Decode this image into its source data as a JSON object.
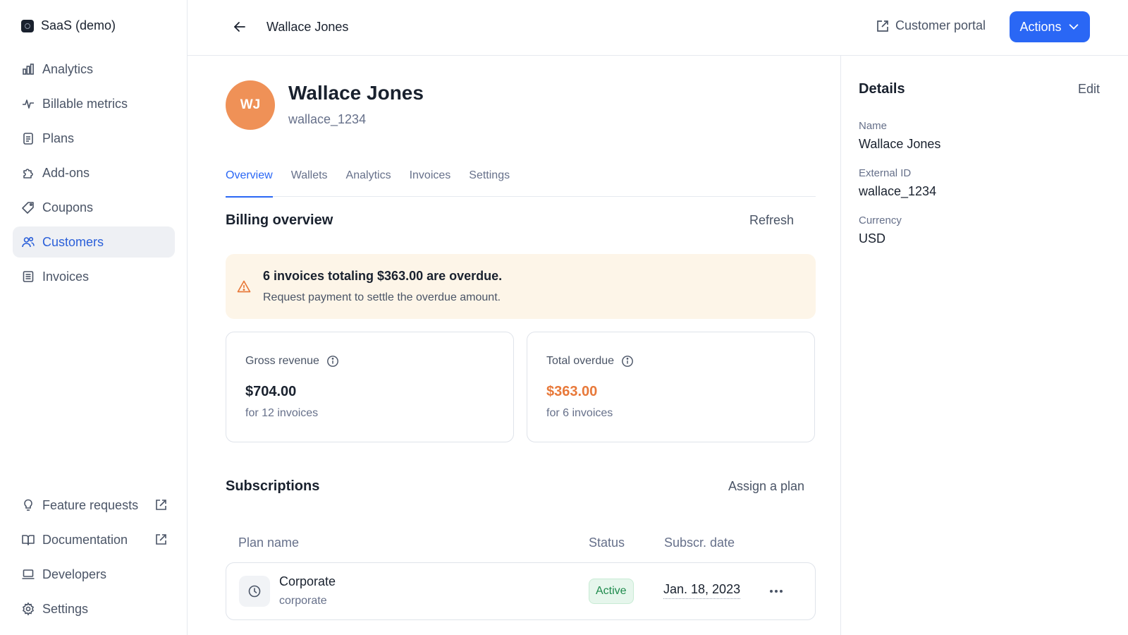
{
  "org": {
    "name": "SaaS (demo)"
  },
  "nav": {
    "items": [
      {
        "label": "Analytics",
        "icon": "bar-chart-icon"
      },
      {
        "label": "Billable metrics",
        "icon": "pulse-icon"
      },
      {
        "label": "Plans",
        "icon": "clipboard-icon"
      },
      {
        "label": "Add-ons",
        "icon": "puzzle-icon"
      },
      {
        "label": "Coupons",
        "icon": "tag-icon"
      },
      {
        "label": "Customers",
        "icon": "users-icon",
        "active": true
      },
      {
        "label": "Invoices",
        "icon": "document-icon"
      }
    ],
    "bottom": [
      {
        "label": "Feature requests",
        "icon": "lightbulb-icon",
        "external": true
      },
      {
        "label": "Documentation",
        "icon": "book-icon",
        "external": true
      },
      {
        "label": "Developers",
        "icon": "laptop-icon"
      },
      {
        "label": "Settings",
        "icon": "gear-icon"
      }
    ]
  },
  "header": {
    "title": "Wallace Jones",
    "portal_label": "Customer portal",
    "actions_label": "Actions"
  },
  "customer": {
    "initials": "WJ",
    "name": "Wallace Jones",
    "external_id": "wallace_1234"
  },
  "tabs": [
    {
      "label": "Overview",
      "active": true
    },
    {
      "label": "Wallets"
    },
    {
      "label": "Analytics"
    },
    {
      "label": "Invoices"
    },
    {
      "label": "Settings"
    }
  ],
  "billing": {
    "title": "Billing overview",
    "refresh_label": "Refresh",
    "alert_title": "6 invoices totaling $363.00 are overdue.",
    "alert_sub": "Request payment to settle the overdue amount.",
    "gross": {
      "label": "Gross revenue",
      "value": "$704.00",
      "sub": "for 12 invoices"
    },
    "overdue": {
      "label": "Total overdue",
      "value": "$363.00",
      "sub": "for 6 invoices"
    }
  },
  "subscriptions": {
    "title": "Subscriptions",
    "assign_label": "Assign a plan",
    "columns": [
      "Plan name",
      "Status",
      "Subscr. date"
    ],
    "rows": [
      {
        "name": "Corporate",
        "code": "corporate",
        "status": "Active",
        "date": "Jan. 18, 2023"
      }
    ]
  },
  "details": {
    "title": "Details",
    "edit_label": "Edit",
    "fields": [
      {
        "label": "Name",
        "value": "Wallace Jones"
      },
      {
        "label": "External ID",
        "value": "wallace_1234"
      },
      {
        "label": "Currency",
        "value": "USD"
      }
    ]
  },
  "colors": {
    "accent": "#2a67f5",
    "avatar": "#ef9157",
    "overdue": "#e8793a",
    "alert_bg": "#fdf5e8",
    "status_green": "#1e8a4c"
  }
}
